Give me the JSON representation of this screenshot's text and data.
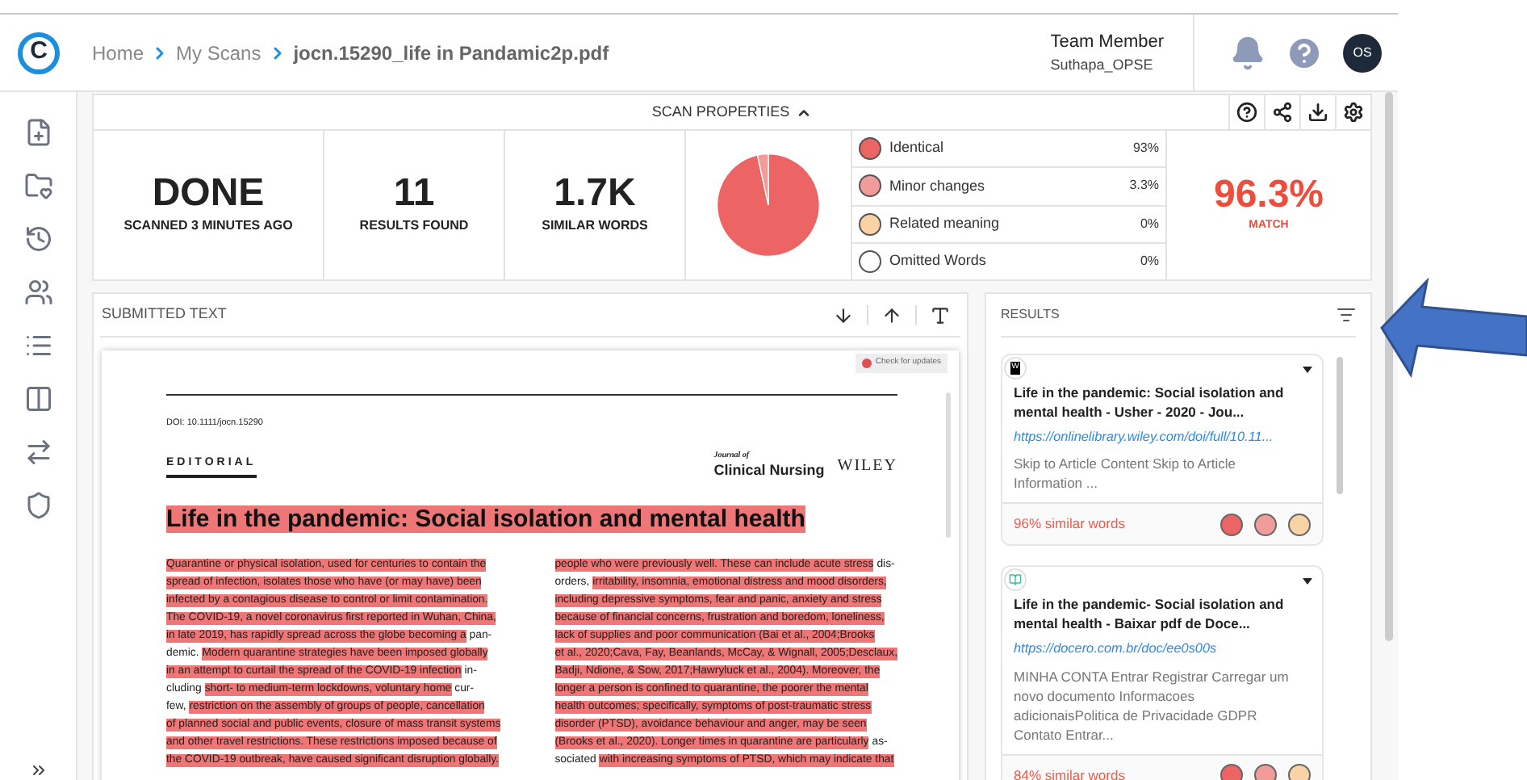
{
  "header": {
    "logo": "C",
    "breadcrumb": [
      {
        "label": "Home",
        "selected": false
      },
      {
        "label": "My Scans",
        "selected": false
      },
      {
        "label": "jocn.15290_life in Pandamic2p.pdf",
        "selected": true
      }
    ],
    "user": {
      "role": "Team Member",
      "name": "Suthapa_OPSE",
      "initials": "OS"
    }
  },
  "scan_properties": {
    "title": "SCAN PROPERTIES",
    "expanded": true,
    "stats": [
      {
        "value": "DONE",
        "label": "SCANNED 3 MINUTES AGO"
      },
      {
        "value": "11",
        "label": "RESULTS FOUND"
      },
      {
        "value": "1.7K",
        "label": "SIMILAR WORDS"
      }
    ],
    "chart_data": {
      "type": "pie",
      "categories": [
        "Identical",
        "Minor changes",
        "Related meaning",
        "Omitted Words"
      ],
      "values": [
        96.57,
        3.43,
        0,
        0
      ]
    },
    "breakdown": [
      {
        "percent": "93%",
        "color": "#ec6464"
      },
      {
        "percent": "3.3%",
        "color": "#f29b9b"
      },
      {
        "percent": "0%",
        "color": "#f9d3a5"
      },
      {
        "percent": "0%",
        "color": "#ffffff"
      }
    ],
    "match": {
      "value": "96.3%",
      "label": "MATCH"
    }
  },
  "submitted_text": {
    "title": "SUBMITTED TEXT",
    "document": {
      "check_updates": "Check for updates",
      "doi": "DOI: 10.1111/jocn.15290",
      "section": "EDITORIAL",
      "journal_small": "Journal of",
      "journal": "Clinical Nursing",
      "publisher": "WILEY",
      "title": "Life in the pandemic: Social isolation and mental health",
      "title_highlighted": true,
      "columns": [
        [
          [
            {
              "text": "Quarantine or physical isolation, used for centuries to contain the",
              "highlighted": true
            }
          ],
          [
            {
              "text": "spread of infection, isolates those who have (or may have) been",
              "highlighted": true
            }
          ],
          [
            {
              "text": "infected by a contagious disease to control or limit contamination.",
              "highlighted": true
            }
          ],
          [
            {
              "text": "The COVID-19, a novel coronavirus first reported in Wuhan, China,",
              "highlighted": true
            }
          ],
          [
            {
              "text": "in late 2019, has rapidly spread across the globe becoming a",
              "highlighted": true
            },
            {
              "text": "pan-",
              "highlighted": false
            }
          ],
          [
            {
              "text": "demic.",
              "highlighted": false
            },
            {
              "text": "Modern quarantine strategies have been imposed globally",
              "highlighted": true
            }
          ],
          [
            {
              "text": "in an attempt to curtail the spread of the COVID-19 infection",
              "highlighted": true
            },
            {
              "text": "in-",
              "highlighted": false
            }
          ],
          [
            {
              "text": "cluding",
              "highlighted": false
            },
            {
              "text": "short- to medium-term lockdowns, voluntary home",
              "highlighted": true
            },
            {
              "text": "cur-",
              "highlighted": false
            }
          ],
          [
            {
              "text": "few,",
              "highlighted": false
            },
            {
              "text": "restriction on the assembly of groups of people, cancellation",
              "highlighted": true
            }
          ],
          [
            {
              "text": "of planned social and public events, closure of mass transit systems",
              "highlighted": true
            }
          ],
          [
            {
              "text": "and other travel restrictions. These restrictions imposed because of",
              "highlighted": true
            }
          ],
          [
            {
              "text": "the COVID-19 outbreak, have caused significant disruption globally.",
              "highlighted": true
            }
          ]
        ],
        [
          [
            {
              "text": "people who were previously well. These can include acute stress",
              "highlighted": true
            },
            {
              "text": "dis-",
              "highlighted": false
            }
          ],
          [
            {
              "text": "orders,",
              "highlighted": false
            },
            {
              "text": "irritability, insomnia, emotional distress and mood disorders,",
              "highlighted": true
            }
          ],
          [
            {
              "text": "including depressive symptoms, fear and panic, anxiety and stress",
              "highlighted": true
            }
          ],
          [
            {
              "text": "because of financial concerns, frustration and boredom, loneliness,",
              "highlighted": true
            }
          ],
          [
            {
              "text": "lack of supplies and poor communication (Bai et al., 2004;Brooks",
              "highlighted": true
            }
          ],
          [
            {
              "text": "et al., 2020;Cava, Fay, Beanlands, McCay, & Wignall, 2005;Desclaux,",
              "highlighted": true
            }
          ],
          [
            {
              "text": "Badji, Ndione, & Sow, 2017;Hawryluck et al., 2004). Moreover, the",
              "highlighted": true
            }
          ],
          [
            {
              "text": "longer a person is confined to quarantine, the poorer the mental",
              "highlighted": true
            }
          ],
          [
            {
              "text": "health outcomes; specifically, symptoms of post-traumatic stress",
              "highlighted": true
            }
          ],
          [
            {
              "text": "disorder (PTSD), avoidance behaviour and anger, may be seen",
              "highlighted": true
            }
          ],
          [
            {
              "text": "(Brooks et al., 2020). Longer times in quarantine are particularly",
              "highlighted": true
            },
            {
              "text": "as-",
              "highlighted": false
            }
          ],
          [
            {
              "text": "sociated",
              "highlighted": false
            },
            {
              "text": "with increasing symptoms of PTSD, which may indicate that",
              "highlighted": true
            }
          ]
        ]
      ]
    }
  },
  "results": {
    "title": "RESULTS",
    "items": [
      {
        "kind": "letter",
        "badge": "W",
        "title": "Life in the pandemic: Social isolation and mental health - Usher - 2020 - Jou...",
        "url": "https://onlinelibrary.wiley.com/doi/full/10.11...",
        "snippet": "Skip to Article Content Skip to Article Information ...",
        "similarity": "96% similar words"
      },
      {
        "kind": "icon",
        "title": "Life in the pandemic- Social isolation and mental health - Baixar pdf de Doce...",
        "url": "https://docero.com.br/doc/ee0s00s",
        "snippet": "MINHA CONTA Entrar Registrar Carregar um novo documento Informacoes adicionaisPolitica de Privacidade GDPR Contato Entrar...",
        "similarity": "84% similar words"
      }
    ]
  }
}
